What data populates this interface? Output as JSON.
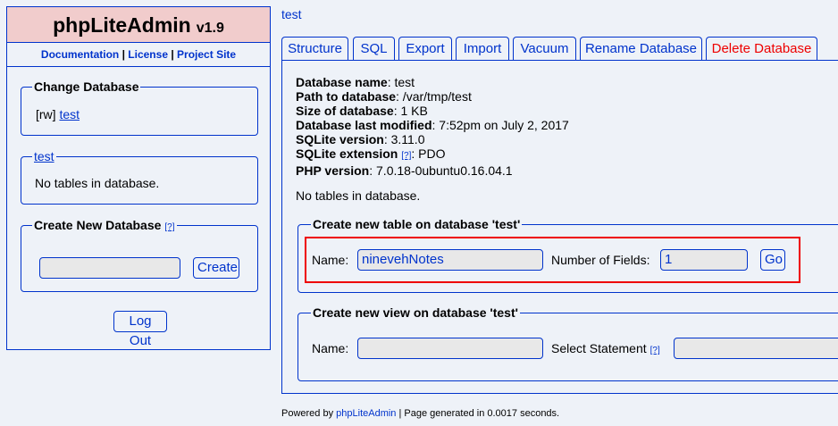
{
  "sidebar": {
    "app_name": "phpLiteAdmin",
    "version": "v1.9",
    "links": {
      "documentation": "Documentation",
      "license": "License",
      "project_site": "Project Site",
      "separator": "|"
    },
    "change_database": {
      "legend": "Change Database",
      "mode": "[rw]",
      "db_link": "test"
    },
    "current_db": {
      "legend_link": "test",
      "message": "No tables in database."
    },
    "create_database": {
      "legend": "Create New Database",
      "hint": "[?]",
      "input_value": "",
      "button": "Create"
    },
    "logout_button": "Log Out"
  },
  "breadcrumb": "test",
  "tabs": [
    {
      "label": "Structure",
      "active": true
    },
    {
      "label": "SQL"
    },
    {
      "label": "Export"
    },
    {
      "label": "Import"
    },
    {
      "label": "Vacuum"
    },
    {
      "label": "Rename Database"
    },
    {
      "label": "Delete Database",
      "color": "#e00000"
    }
  ],
  "info": {
    "name_label": "Database name",
    "name_value": ": test",
    "path_label": "Path to database",
    "path_value": ": /var/tmp/test",
    "size_label": "Size of database",
    "size_value": ": 1 KB",
    "modified_label": "Database last modified",
    "modified_value": ": 7:52pm on July 2, 2017",
    "sqlite_version_label": "SQLite version",
    "sqlite_version_value": ": 3.11.0",
    "sqlite_ext_label": "SQLite extension",
    "sqlite_ext_hint": "[?]",
    "sqlite_ext_value": ": PDO",
    "php_version_label": "PHP version",
    "php_version_value": ": 7.0.18-0ubuntu0.16.04.1"
  },
  "no_tables_message": "No tables in database.",
  "create_table": {
    "legend": "Create new table on database 'test'",
    "name_label": "Name:",
    "name_value": "ninevehNotes",
    "fields_label": "Number of Fields:",
    "fields_value": "1",
    "go_button": "Go"
  },
  "create_view": {
    "legend": "Create new view on database 'test'",
    "name_label": "Name:",
    "name_value": "",
    "select_label": "Select Statement",
    "select_hint": "[?]",
    "select_value": ""
  },
  "footer": {
    "prefix": "Powered by",
    "link": "phpLiteAdmin",
    "suffix": "| Page generated in 0.0017 seconds."
  },
  "colors": {
    "accent": "#0033cc",
    "header_bg": "#f1cccc",
    "page_bg": "#eef2f8",
    "danger": "#e00000"
  }
}
